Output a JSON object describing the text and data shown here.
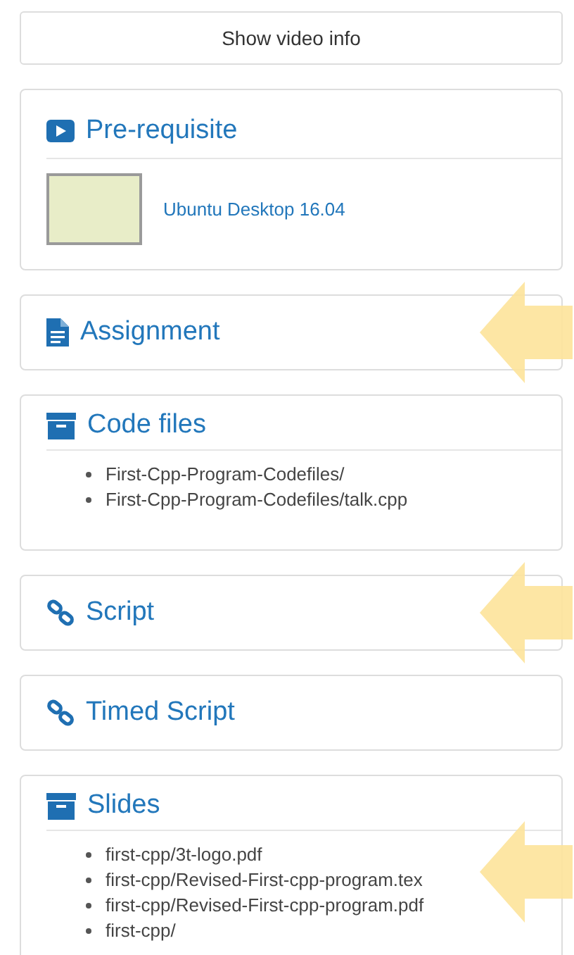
{
  "video_info_button": {
    "label": "Show video info"
  },
  "sections": [
    {
      "kind": "prerequisite",
      "title": "Pre-requisite",
      "link": "Ubuntu Desktop 16.04",
      "arrow": false
    },
    {
      "kind": "assignment",
      "title": "Assignment",
      "arrow": true
    },
    {
      "kind": "files",
      "title": "Code files",
      "items": [
        "First-Cpp-Program-Codefiles/",
        "First-Cpp-Program-Codefiles/talk.cpp"
      ],
      "arrow": false
    },
    {
      "kind": "link",
      "title": "Script",
      "arrow": true
    },
    {
      "kind": "link",
      "title": "Timed Script",
      "arrow": false
    },
    {
      "kind": "files",
      "title": "Slides",
      "items": [
        "first-cpp/3t-logo.pdf",
        "first-cpp/Revised-First-cpp-program.tex",
        "first-cpp/Revised-First-cpp-program.pdf",
        "first-cpp/"
      ],
      "arrow": true
    }
  ]
}
